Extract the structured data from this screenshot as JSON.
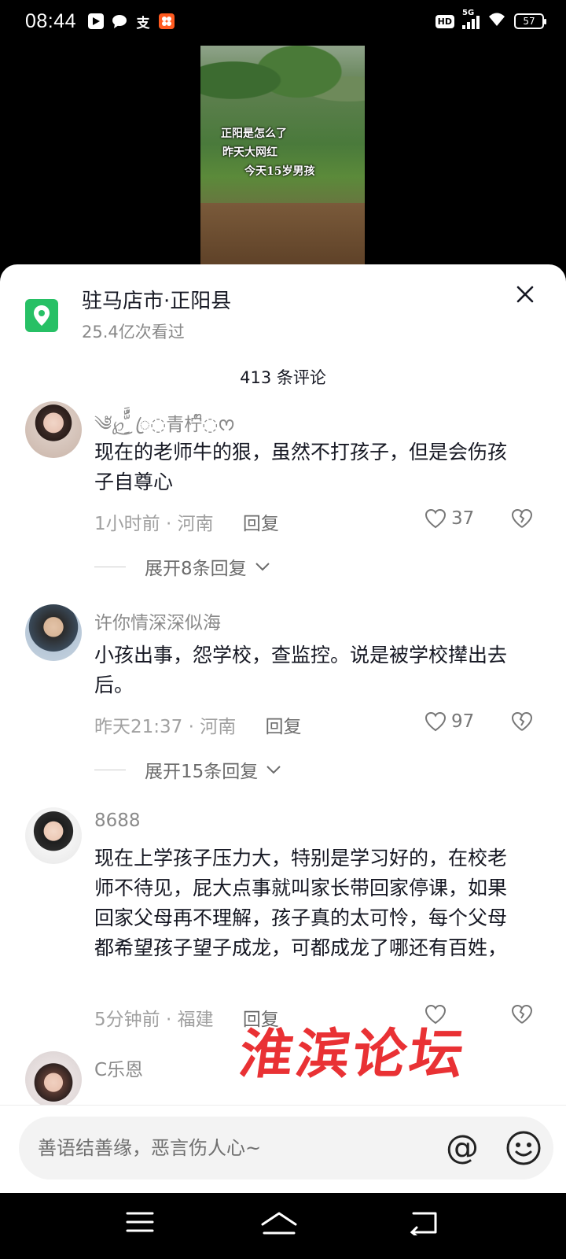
{
  "status_bar": {
    "time": "08:44",
    "hd": "HD",
    "network": "5G",
    "battery": "57",
    "app_icons": [
      "video-app-icon",
      "message-icon",
      "alipay-icon",
      "taobao-icon"
    ]
  },
  "video": {
    "caption_lines": [
      "正阳是怎么了",
      "昨天大网红",
      "今天15岁男孩"
    ]
  },
  "location": {
    "title": "驻马店市·正阳县",
    "views": "25.4亿次看过",
    "icon": "location-pin-icon",
    "icon_color": "#27c065"
  },
  "comments_header": {
    "count": "413 条评论"
  },
  "comments": [
    {
      "username": "༄ั℘͜ َُِّّ ꦿ◌青柠ᩚ◌ᰔ",
      "text": "现在的老师牛的狠，虽然不打孩子，但是会伤孩子自尊心",
      "time": "1小时前",
      "region": "河南",
      "reply": "回复",
      "likes": "37",
      "expand": "展开8条回复"
    },
    {
      "username": "许你情深深似海",
      "text": "小孩出事，怨学校，查监控。说是被学校撵出去后。",
      "time": "昨天21:37",
      "region": "河南",
      "reply": "回复",
      "likes": "97",
      "expand": "展开15条回复"
    },
    {
      "username": "8688",
      "text": "现在上学孩子压力大，特别是学习好的，在校老师不待见，屁大点事就叫家长带回家停课，如果回家父母再不理解，孩子真的太可怜，每个父母都希望孩子望子成龙，可都成龙了哪还有百姓，",
      "time": "5分钟前",
      "region": "福建",
      "reply": "回复",
      "likes": ""
    },
    {
      "username": "C乐恩"
    }
  ],
  "separator": "·",
  "watermark": "淮滨论坛",
  "input": {
    "placeholder": "善语结善缘，恶言伤人心~",
    "at_label": "@"
  },
  "colors": {
    "watermark": "#e8262a",
    "background": "#ffffff"
  }
}
